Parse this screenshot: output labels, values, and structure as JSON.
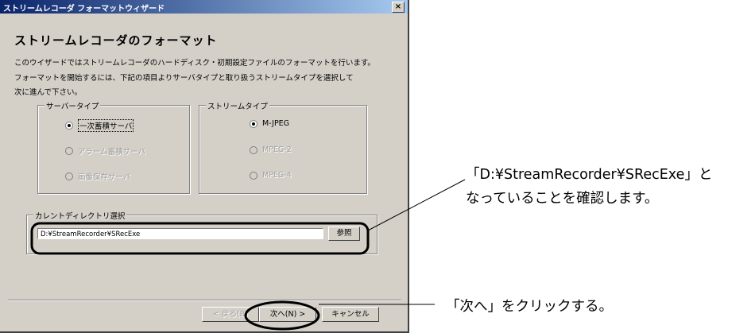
{
  "window": {
    "title": "ストリームレコーダ フォーマットウィザード",
    "close_label": "×"
  },
  "heading": "ストリームレコーダのフォーマット",
  "description": [
    "このウイザードではストリームレコーダのハードディスク・初期設定ファイルのフォーマットを行います。",
    "フォーマットを開始するには、下記の項目よりサーバタイプと取り扱うストリームタイプを選択して",
    "次に進んで下さい。"
  ],
  "server_type": {
    "label": "サーバータイプ",
    "options": [
      {
        "label": "一次蓄積サーバ",
        "selected": true,
        "enabled": true
      },
      {
        "label": "アラーム蓄積サーバ",
        "selected": false,
        "enabled": false
      },
      {
        "label": "画像保存サーバ",
        "selected": false,
        "enabled": false
      }
    ]
  },
  "stream_type": {
    "label": "ストリームタイプ",
    "options": [
      {
        "label": "M-JPEG",
        "selected": true,
        "enabled": true
      },
      {
        "label": "MPEG-2",
        "selected": false,
        "enabled": false
      },
      {
        "label": "MPEG-4",
        "selected": false,
        "enabled": false
      }
    ]
  },
  "current_dir": {
    "label": "カレントディレクトリ選択",
    "value": "D:¥StreamRecorder¥SRecExe",
    "browse_label": "参照"
  },
  "buttons": {
    "back": "< 戻る(B)",
    "next": "次へ(N) >",
    "cancel": "キャンセル"
  },
  "annotations": {
    "dir_line1": "「D:¥StreamRecorder¥SRecExe」と",
    "dir_line2": "なっていることを確認します。",
    "next": "「次へ」をクリックする。"
  },
  "colors": {
    "titlebar_start": "#0a246a",
    "titlebar_end": "#a6caf0",
    "dialog_bg": "#d4d0c8"
  }
}
